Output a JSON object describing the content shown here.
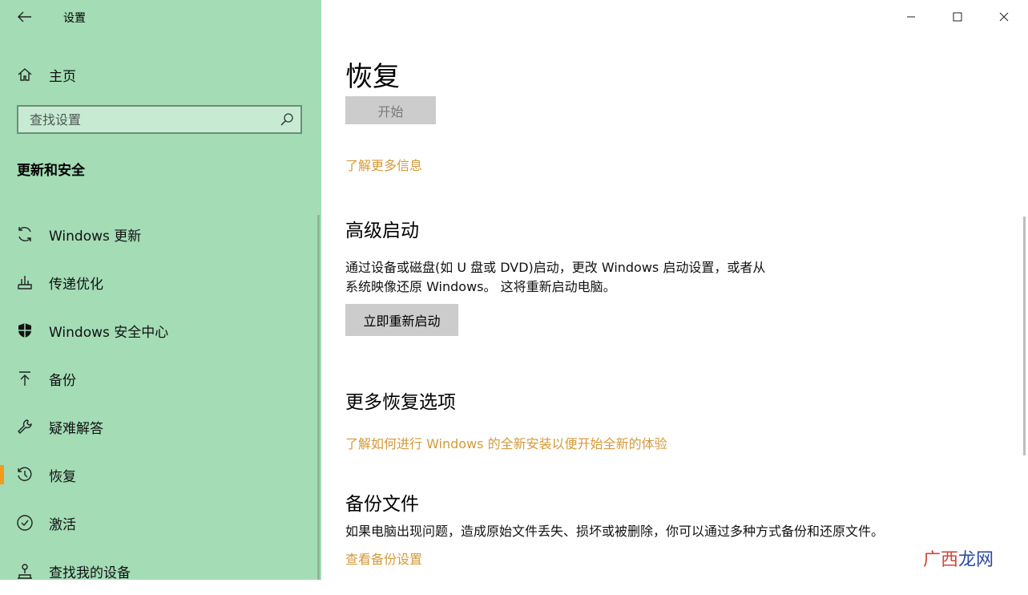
{
  "window": {
    "title": "设置",
    "controls": {
      "minimize": "—",
      "maximize": "☐",
      "close": "✕"
    }
  },
  "sidebar": {
    "home_label": "主页",
    "search_placeholder": "查找设置",
    "section_title": "更新和安全",
    "items": [
      {
        "label": "Windows 更新",
        "icon": "sync-icon"
      },
      {
        "label": "传递优化",
        "icon": "delivery-optimization-icon"
      },
      {
        "label": "Windows 安全中心",
        "icon": "shield-icon"
      },
      {
        "label": "备份",
        "icon": "backup-arrow-icon"
      },
      {
        "label": "疑难解答",
        "icon": "wrench-icon"
      },
      {
        "label": "恢复",
        "icon": "recovery-history-icon",
        "selected": true
      },
      {
        "label": "激活",
        "icon": "activation-check-icon"
      },
      {
        "label": "查找我的设备",
        "icon": "find-device-person-icon"
      }
    ]
  },
  "main": {
    "page_title": "恢复",
    "start_button": "开始",
    "learn_more_link": "了解更多信息",
    "advanced_startup": {
      "heading": "高级启动",
      "description_line1": "通过设备或磁盘(如 U 盘或 DVD)启动，更改 Windows 启动设置，或者从",
      "description_line2": "系统映像还原 Windows。 这将重新启动电脑。",
      "restart_button": "立即重新启动"
    },
    "more_recovery": {
      "heading": "更多恢复选项",
      "link": "了解如何进行 Windows 的全新安装以便开始全新的体验"
    },
    "backup_files": {
      "heading": "备份文件",
      "description": "如果电脑出现问题，造成原始文件丢失、损坏或被删除，你可以通过多种方式备份和还原文件。",
      "link": "查看备份设置"
    }
  },
  "watermark": {
    "part1": "广西",
    "part2": "龙网"
  },
  "colors": {
    "sidebar_bg": "#a3dcb5",
    "accent_link": "#d49a3a",
    "selected_indicator": "#f59a1d",
    "button_bg": "#cccccc"
  }
}
